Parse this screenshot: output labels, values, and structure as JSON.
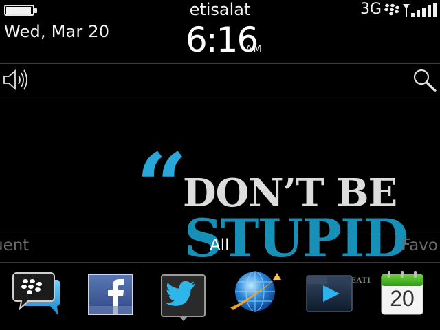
{
  "status": {
    "battery_level": 0.95,
    "date": "Wed, Mar 20",
    "carrier": "etisalat",
    "time": "6:16",
    "ampm": "AM",
    "network": "3G"
  },
  "wallpaper": {
    "line1": "DON’T BE",
    "line2": "STUPID",
    "credit": "BE CREATI"
  },
  "tabs": {
    "left": "uent",
    "center": "All",
    "right": "Favo"
  },
  "dock": {
    "calendar_day": "20"
  },
  "colors": {
    "quote_blue": "#2aa7d8",
    "stupid_blue": "#1790b8",
    "light_text": "#dcdcdc"
  },
  "icons": [
    "battery-icon",
    "blackberry-dots-icon",
    "signal-icon",
    "speaker-icon",
    "search-icon",
    "bbm-icon",
    "facebook-icon",
    "twitter-icon",
    "browser-icon",
    "media-icon",
    "calendar-icon"
  ]
}
